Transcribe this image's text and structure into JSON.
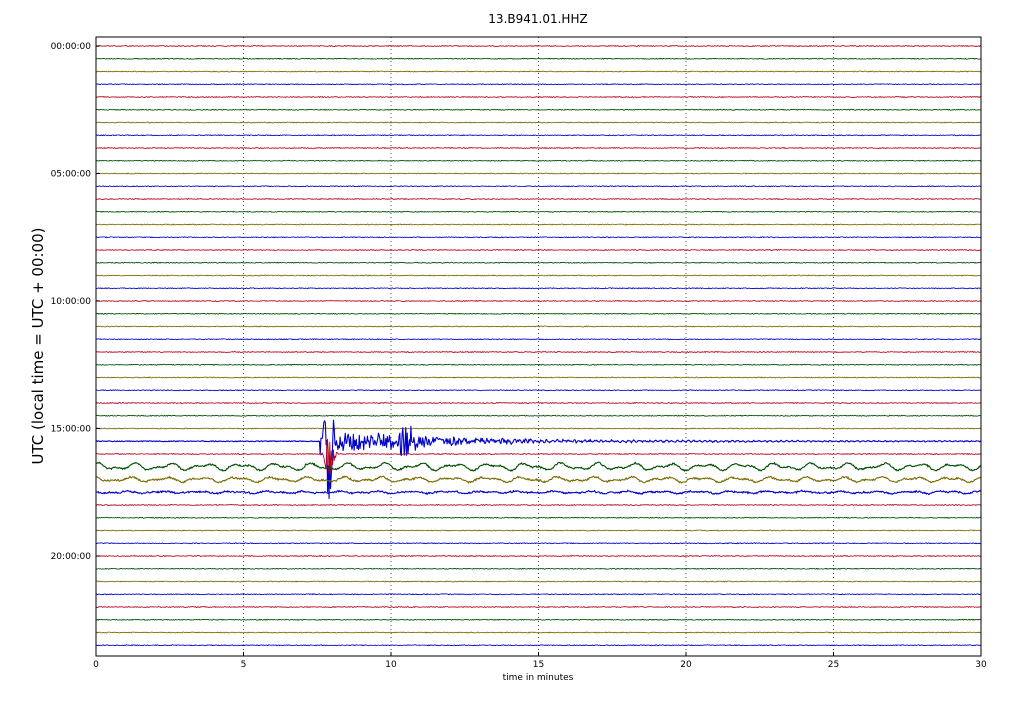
{
  "chart_data": {
    "type": "line",
    "title": "13.B941.01.HHZ",
    "xlabel": "time in minutes",
    "ylabel": "UTC (local time = UTC + 00:00)",
    "xlim": [
      0,
      30
    ],
    "x_ticks": [
      0,
      5,
      10,
      15,
      20,
      25,
      30
    ],
    "x_tick_labels": [
      "0",
      "5",
      "10",
      "15",
      "20",
      "25",
      "30"
    ],
    "y_tick_labels": [
      "00:00:00",
      "05:00:00",
      "10:00:00",
      "15:00:00",
      "20:00:00"
    ],
    "y_tick_hours": [
      0,
      5,
      10,
      15,
      20
    ],
    "trace_interval_minutes": 30,
    "trace_count": 48,
    "grid": "vertical-dotted",
    "legend": "none",
    "color_cycle": [
      "#b3001a",
      "#004d00",
      "#7a6a00",
      "#0000cc"
    ],
    "event": {
      "onset_trace_hour": 15.5,
      "onset_minute": 7.6,
      "peak_minute": 7.9,
      "secondary_minute": 10.5,
      "peak_values": [
        1.0,
        -0.6,
        0.55,
        -0.45
      ],
      "description": "large seismic arrival"
    },
    "noise_segments": [
      {
        "trace_hour": 16.5,
        "start_minute": 0,
        "end_minute": 30,
        "level": "high"
      },
      {
        "trace_hour": 17.0,
        "start_minute": 0,
        "end_minute": 30,
        "level": "medium"
      },
      {
        "trace_hour": 17.5,
        "start_minute": 0,
        "end_minute": 30,
        "level": "low"
      }
    ]
  }
}
